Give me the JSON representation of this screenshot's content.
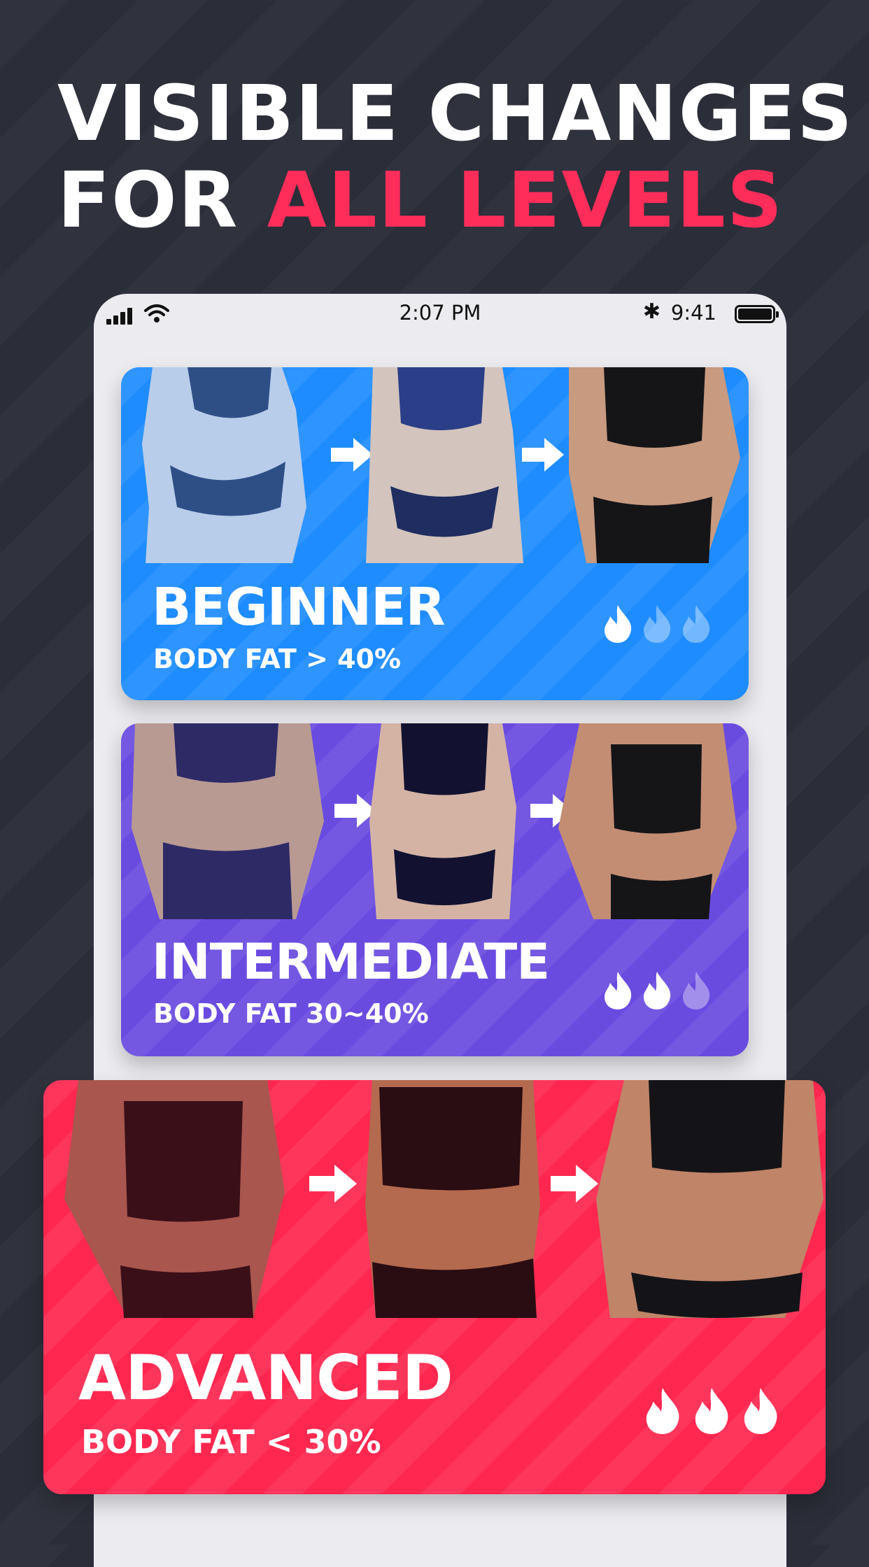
{
  "headline": {
    "line1": "VISIBLE CHANGES",
    "line2_prefix": "FOR ",
    "line2_accent": "ALL LEVELS"
  },
  "colors": {
    "background": "#2b2d38",
    "accent": "#ff2d5a",
    "beginner": "#1e8cff",
    "intermediate": "#6a4be0",
    "advanced": "#ff2750"
  },
  "status_bar": {
    "center_time": "2:07 PM",
    "right_time": "9:41",
    "icons": [
      "signal-icon",
      "wifi-icon",
      "bluetooth-icon",
      "battery-icon"
    ]
  },
  "levels": [
    {
      "title": "BEGINNER",
      "subtitle": "BODY FAT > 40%",
      "flames_active": 1,
      "flames_total": 3
    },
    {
      "title": "INTERMEDIATE",
      "subtitle": "BODY FAT 30~40%",
      "flames_active": 2,
      "flames_total": 3
    },
    {
      "title": "ADVANCED",
      "subtitle": "BODY FAT < 30%",
      "flames_active": 3,
      "flames_total": 3
    }
  ]
}
